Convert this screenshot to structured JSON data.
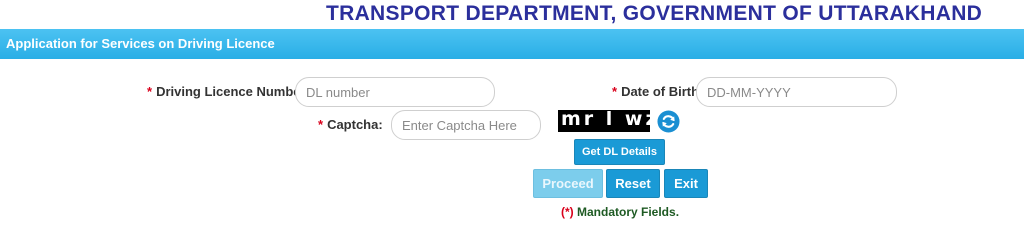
{
  "header": {
    "department_title": "TRANSPORT DEPARTMENT, GOVERNMENT OF UTTARAKHAND"
  },
  "section": {
    "title": "Application for Services on Driving Licence"
  },
  "form": {
    "required_marker": "*",
    "dl_number": {
      "label": "Driving Licence Number",
      "placeholder": "DL number",
      "value": ""
    },
    "dob": {
      "label": "Date of Birth",
      "placeholder": "DD-MM-YYYY",
      "value": ""
    },
    "captcha": {
      "label": "Captcha:",
      "placeholder": "Enter Captcha Here",
      "value": "",
      "image_text": "mr l wz x",
      "refresh_icon": "refresh-icon"
    }
  },
  "buttons": {
    "get_dl_details": "Get DL Details",
    "proceed": "Proceed",
    "reset": "Reset",
    "exit": "Exit"
  },
  "footer_note": {
    "marker": "(*)",
    "text": " Mandatory Fields."
  },
  "colors": {
    "title": "#2b2f9c",
    "section_bar": "#29aee6",
    "button": "#1a9ad6",
    "button_disabled": "#7ccdec",
    "required": "#d9001b",
    "note": "#1e5a23"
  }
}
